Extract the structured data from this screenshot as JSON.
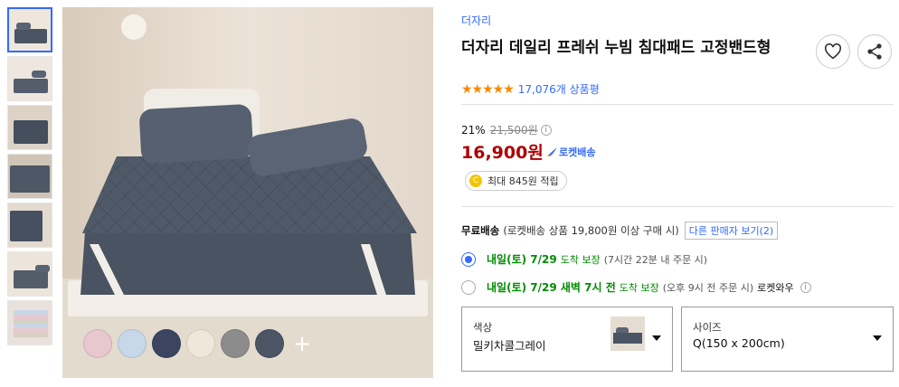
{
  "gallery": {
    "thumbnails": [
      "thumb-1",
      "thumb-2",
      "thumb-3",
      "thumb-4",
      "thumb-5",
      "thumb-6",
      "thumb-7"
    ],
    "swatch_colors": [
      "#e8c8cf",
      "#c6d8ea",
      "#3b4560",
      "#efe8da",
      "#8c8c8c",
      "#4c5563"
    ],
    "more_label": "+"
  },
  "product": {
    "brand": "더자리",
    "title": "더자리 데일리 프레쉬 누빔 침대패드 고정밴드형",
    "stars": "★★★★★",
    "rating": 4.5,
    "review_count": "17,076개 상품평",
    "discount_rate": "21%",
    "original_price": "21,500원",
    "info_icon": "i",
    "price": "16,900원",
    "rocket_label": "로켓배송",
    "reward_coin": "C",
    "reward": "최대 845원 적립"
  },
  "shipping": {
    "label": "무료배송",
    "condition": "(로켓배송 상품 19,800원 이상 구매 시)",
    "other_sellers": "다른 판매자 보기(2)"
  },
  "delivery_options": [
    {
      "day": "내일(토) 7/29",
      "detail": "도착 보장",
      "note": "(7시간 22분 내 주문 시)",
      "selected": true
    },
    {
      "day": "내일(토) 7/29 새벽 7시 전",
      "detail": "도착 보장",
      "note": "(오후 9시 전 주문 시)",
      "extra": "로켓와우",
      "selected": false
    }
  ],
  "selectors": {
    "color": {
      "label": "색상",
      "value": "밀키차콜그레이"
    },
    "size": {
      "label": "사이즈",
      "value": "Q(150 x 200cm)"
    }
  },
  "icons": {
    "wishlist": "heart-icon",
    "share": "share-icon",
    "rocket": "rocket-icon"
  },
  "colors": {
    "accent": "#346aff",
    "price": "#ae0000",
    "green": "#008c00",
    "star": "#f58a00"
  }
}
